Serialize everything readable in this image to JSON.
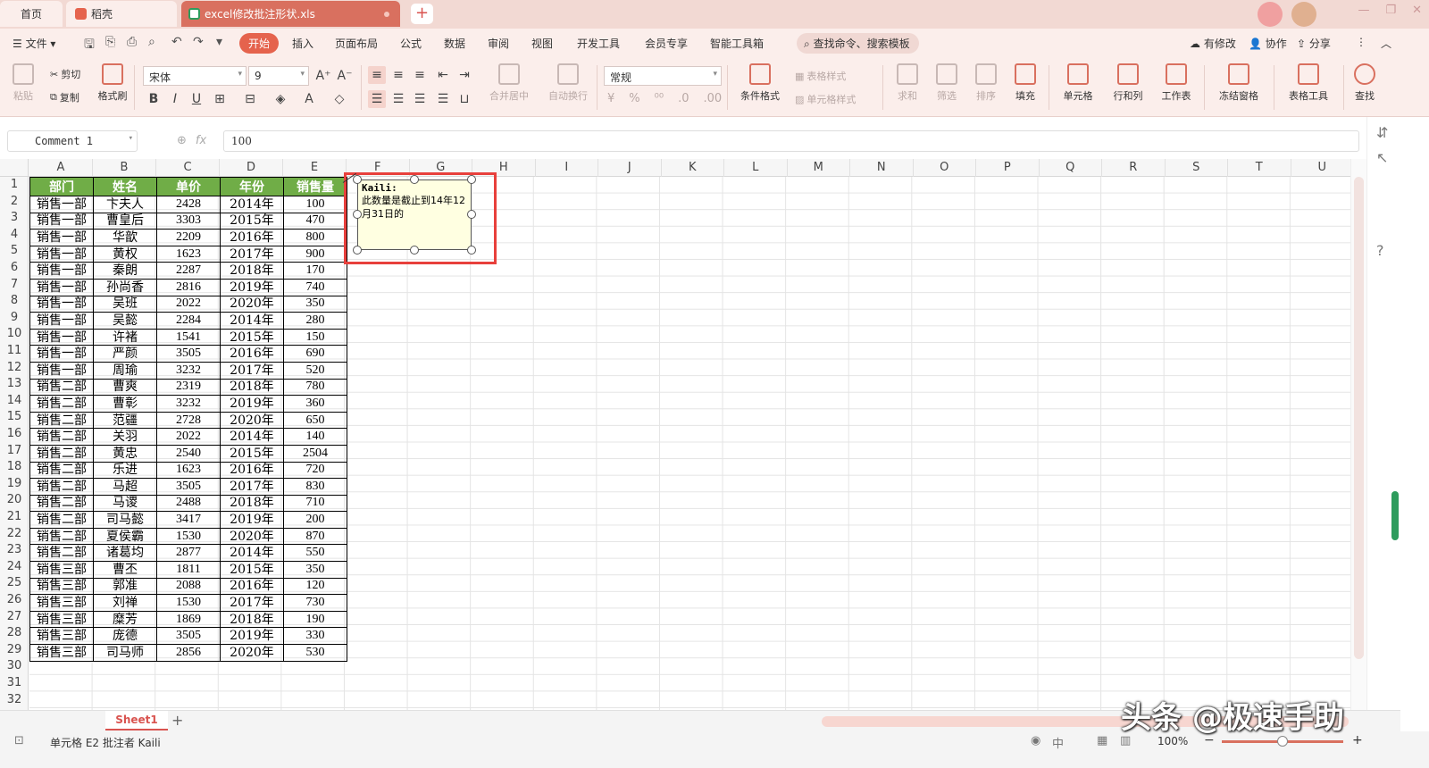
{
  "tabs": [
    {
      "label": "首页"
    },
    {
      "label": "稻壳"
    },
    {
      "label": "excel修改批注形状.xls"
    }
  ],
  "menu": {
    "file": "文件",
    "items": [
      "开始",
      "插入",
      "页面布局",
      "公式",
      "数据",
      "审阅",
      "视图",
      "开发工具",
      "会员专享",
      "智能工具箱"
    ],
    "search": "查找命令、搜索模板",
    "changed": "有修改",
    "collab": "协作",
    "share": "分享"
  },
  "ribbon": {
    "paste": "粘贴",
    "cut": "剪切",
    "copy": "复制",
    "format_painter": "格式刷",
    "font_name": "宋体",
    "font_size": "9",
    "merge": "合并居中",
    "wrap": "自动换行",
    "number_format": "常规",
    "cond_format": "条件格式",
    "table_style": "表格样式",
    "cell_style": "单元格样式",
    "sum": "求和",
    "filter": "筛选",
    "sort": "排序",
    "fill": "填充",
    "cell": "单元格",
    "row_col": "行和列",
    "sheet": "工作表",
    "freeze": "冻结窗格",
    "table_tools": "表格工具",
    "find": "查找"
  },
  "formula_bar": {
    "name_box": "Comment 1",
    "value": "100"
  },
  "columns": [
    "A",
    "B",
    "C",
    "D",
    "E",
    "F",
    "G",
    "H",
    "I",
    "J",
    "K",
    "L",
    "M",
    "N",
    "O",
    "P",
    "Q",
    "R",
    "S",
    "T",
    "U"
  ],
  "rows": [
    1,
    2,
    3,
    4,
    5,
    6,
    7,
    8,
    9,
    10,
    11,
    12,
    13,
    14,
    15,
    16,
    17,
    18,
    19,
    20,
    21,
    22,
    23,
    24,
    25,
    26,
    27,
    28,
    29,
    30,
    31,
    32
  ],
  "table": {
    "headers": [
      "部门",
      "姓名",
      "单价",
      "年份",
      "销售量"
    ],
    "rows": [
      [
        "销售一部",
        "卞夫人",
        "2428",
        "2014年",
        "100"
      ],
      [
        "销售一部",
        "曹皇后",
        "3303",
        "2015年",
        "470"
      ],
      [
        "销售一部",
        "华歆",
        "2209",
        "2016年",
        "800"
      ],
      [
        "销售一部",
        "黄权",
        "1623",
        "2017年",
        "900"
      ],
      [
        "销售一部",
        "秦朗",
        "2287",
        "2018年",
        "170"
      ],
      [
        "销售一部",
        "孙尚香",
        "2816",
        "2019年",
        "740"
      ],
      [
        "销售一部",
        "吴班",
        "2022",
        "2020年",
        "350"
      ],
      [
        "销售一部",
        "吴懿",
        "2284",
        "2014年",
        "280"
      ],
      [
        "销售一部",
        "许褚",
        "1541",
        "2015年",
        "150"
      ],
      [
        "销售一部",
        "严颜",
        "3505",
        "2016年",
        "690"
      ],
      [
        "销售一部",
        "周瑜",
        "3232",
        "2017年",
        "520"
      ],
      [
        "销售二部",
        "曹爽",
        "2319",
        "2018年",
        "780"
      ],
      [
        "销售二部",
        "曹彰",
        "3232",
        "2019年",
        "360"
      ],
      [
        "销售二部",
        "范疆",
        "2728",
        "2020年",
        "650"
      ],
      [
        "销售二部",
        "关羽",
        "2022",
        "2014年",
        "140"
      ],
      [
        "销售二部",
        "黄忠",
        "2540",
        "2015年",
        "2504"
      ],
      [
        "销售二部",
        "乐进",
        "1623",
        "2016年",
        "720"
      ],
      [
        "销售二部",
        "马超",
        "3505",
        "2017年",
        "830"
      ],
      [
        "销售二部",
        "马谡",
        "2488",
        "2018年",
        "710"
      ],
      [
        "销售二部",
        "司马懿",
        "3417",
        "2019年",
        "200"
      ],
      [
        "销售二部",
        "夏侯霸",
        "1530",
        "2020年",
        "870"
      ],
      [
        "销售二部",
        "诸葛均",
        "2877",
        "2014年",
        "550"
      ],
      [
        "销售三部",
        "曹丕",
        "1811",
        "2015年",
        "350"
      ],
      [
        "销售三部",
        "郭准",
        "2088",
        "2016年",
        "120"
      ],
      [
        "销售三部",
        "刘禅",
        "1530",
        "2017年",
        "730"
      ],
      [
        "销售三部",
        "糜芳",
        "1869",
        "2018年",
        "190"
      ],
      [
        "销售三部",
        "庞德",
        "3505",
        "2019年",
        "330"
      ],
      [
        "销售三部",
        "司马师",
        "2856",
        "2020年",
        "530"
      ]
    ]
  },
  "comment": {
    "author": "Kaili:",
    "text": "此数量是截止到14年12月31日的"
  },
  "sheet_tab": "Sheet1",
  "status": {
    "text": "单元格 E2 批注者 Kaili",
    "zoom": "100%"
  },
  "watermark": "头条 @极速手助",
  "colors": {
    "accent": "#e5634d",
    "header_green": "#70ad47",
    "comment_bg": "#ffffe1",
    "highlight_red": "#e8403c"
  }
}
